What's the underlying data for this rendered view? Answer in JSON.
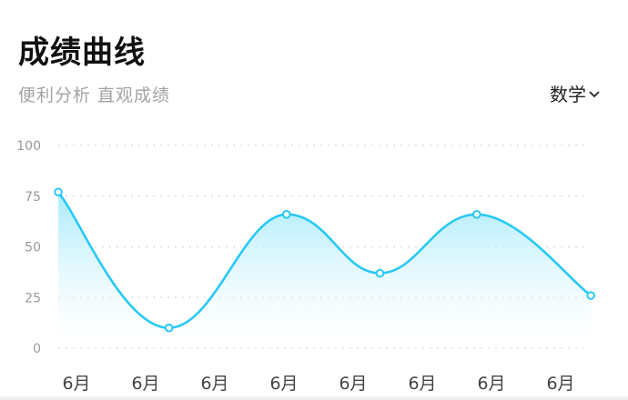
{
  "header": {
    "title": "成绩曲线",
    "subtitle": "便利分析 直观成绩",
    "subject_selected": "数学"
  },
  "colors": {
    "line": "#29c9f3",
    "fill_top": "#9ee8fb",
    "grid": "#d6d6d6",
    "tick": "#999999",
    "xlabel": "#444444"
  },
  "chart_data": {
    "type": "area",
    "title": "成绩曲线",
    "subtitle": "便利分析 直观成绩",
    "categories": [
      "6月",
      "6月",
      "6月",
      "6月",
      "6月",
      "6月",
      "6月",
      "6月"
    ],
    "y_ticks": [
      "100",
      "75",
      "50",
      "25",
      "0"
    ],
    "ylim": [
      0,
      100
    ],
    "grid": true,
    "smooth": true,
    "series": [
      {
        "points": [
          {
            "x_index": 0,
            "y": 77
          },
          {
            "x_index": 1.6,
            "y": 10
          },
          {
            "x_index": 3.3,
            "y": 66
          },
          {
            "x_index": 4.65,
            "y": 37
          },
          {
            "x_index": 6.05,
            "y": 66
          },
          {
            "x_index": 7.7,
            "y": 26
          }
        ]
      }
    ]
  }
}
